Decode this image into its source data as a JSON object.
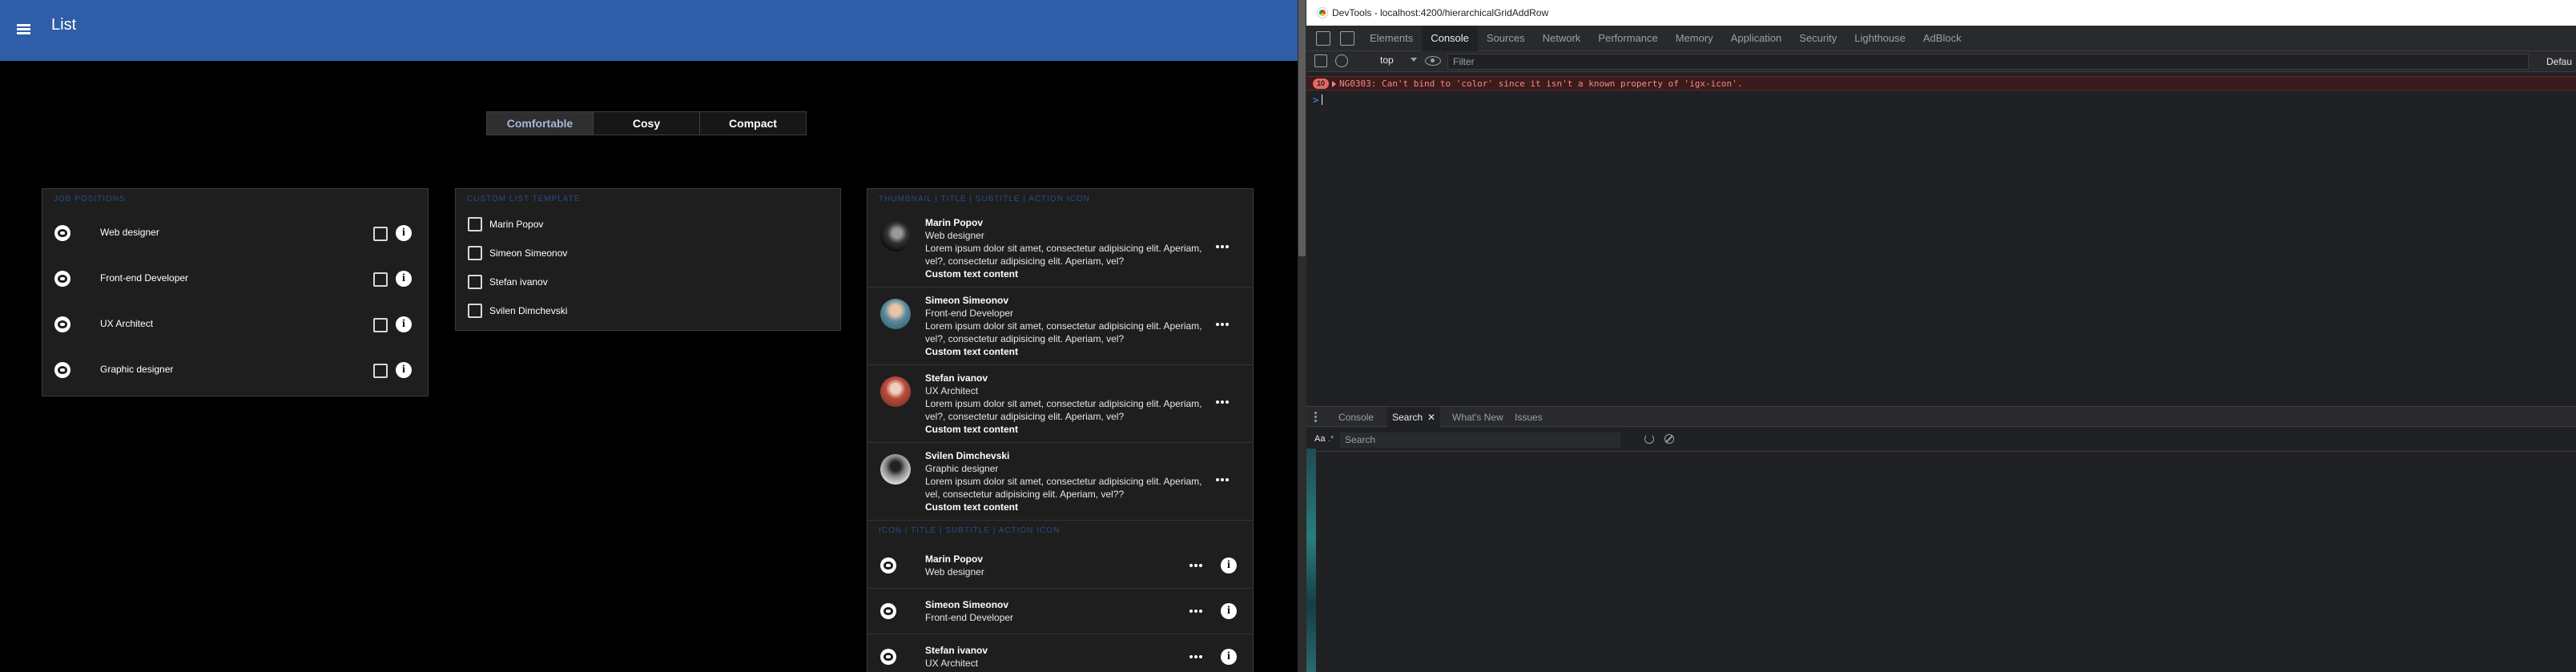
{
  "app": {
    "title": "List",
    "density": [
      "Comfortable",
      "Cosy",
      "Compact"
    ],
    "density_active": 0
  },
  "card1": {
    "header": "JOB POSITIONS",
    "items": [
      "Web designer",
      "Front-end Developer",
      "UX Architect",
      "Graphic designer"
    ]
  },
  "card2": {
    "header": "CUSTOM LIST TEMPLATE",
    "items": [
      "Marin Popov",
      "Simeon Simeonov",
      "Stefan ivanov",
      "Svilen Dimchevski"
    ]
  },
  "card3": {
    "header": "THUMBNAIL | TITLE | SUBTITLE | ACTION ICON",
    "items": [
      {
        "name": "Marin Popov",
        "role": "Web designer",
        "desc": "Lorem ipsum dolor sit amet, consectetur adipisicing elit. Aperiam, vel?, consectetur adipisicing elit. Aperiam, vel?",
        "custom": "Custom text content"
      },
      {
        "name": "Simeon Simeonov",
        "role": "Front-end Developer",
        "desc": "Lorem ipsum dolor sit amet, consectetur adipisicing elit. Aperiam, vel?, consectetur adipisicing elit. Aperiam, vel?",
        "custom": "Custom text content"
      },
      {
        "name": "Stefan ivanov",
        "role": "UX Architect",
        "desc": "Lorem ipsum dolor sit amet, consectetur adipisicing elit. Aperiam, vel?, consectetur adipisicing elit. Aperiam, vel?",
        "custom": "Custom text content"
      },
      {
        "name": "Svilen Dimchevski",
        "role": "Graphic designer",
        "desc": "Lorem ipsum dolor sit amet, consectetur adipisicing elit. Aperiam, vel, consectetur adipisicing elit. Aperiam, vel??",
        "custom": "Custom text content"
      }
    ],
    "section2_header": "ICON | TITLE | SUBTITLE | ACTION ICON",
    "items2": [
      {
        "name": "Marin Popov",
        "role": "Web designer"
      },
      {
        "name": "Simeon Simeonov",
        "role": "Front-end Developer"
      },
      {
        "name": "Stefan ivanov",
        "role": "UX Architect"
      }
    ]
  },
  "devtools": {
    "window_title": "DevTools - localhost:4200/hierarchicalGridAddRow",
    "tabs": [
      "Elements",
      "Console",
      "Sources",
      "Network",
      "Performance",
      "Memory",
      "Application",
      "Security",
      "Lighthouse",
      "AdBlock"
    ],
    "active_tab": "Console",
    "context": "top",
    "filter_placeholder": "Filter",
    "default_levels": "Defau",
    "error_count": "10",
    "error_text": "NG0303: Can't bind to 'color' since it isn't a known property of 'igx-icon'.",
    "drawer_tabs": [
      "Console",
      "Search",
      "What's New",
      "Issues"
    ],
    "drawer_active": "Search",
    "search_case_label": "Aa",
    "search_regex_label": ".*",
    "search_placeholder": "Search"
  }
}
